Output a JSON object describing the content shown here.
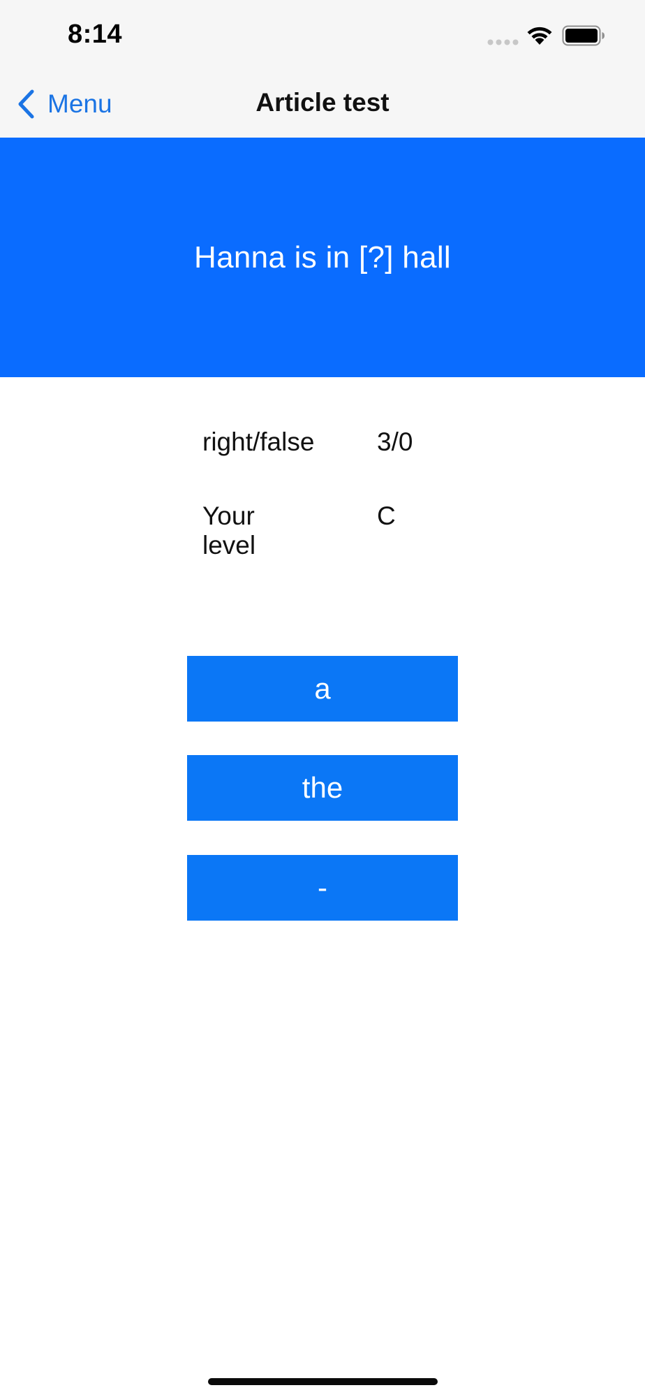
{
  "status_bar": {
    "time": "8:14"
  },
  "nav": {
    "back_label": "Menu",
    "title": "Article test"
  },
  "question": {
    "text": "Hanna is in [?] hall"
  },
  "stats": [
    {
      "label": "right/false",
      "value": "3/0"
    },
    {
      "label": "Your level",
      "value": "C"
    }
  ],
  "answers": [
    "a",
    "the",
    "-"
  ],
  "colors": {
    "banner": "#0a6cff",
    "button": "#0b77f6",
    "link": "#1b74e4",
    "bar_background": "#f6f6f6"
  },
  "icons": {
    "back": "chevron-left-icon",
    "signal": "signal-dots-icon",
    "wifi": "wifi-icon",
    "battery": "battery-icon"
  }
}
